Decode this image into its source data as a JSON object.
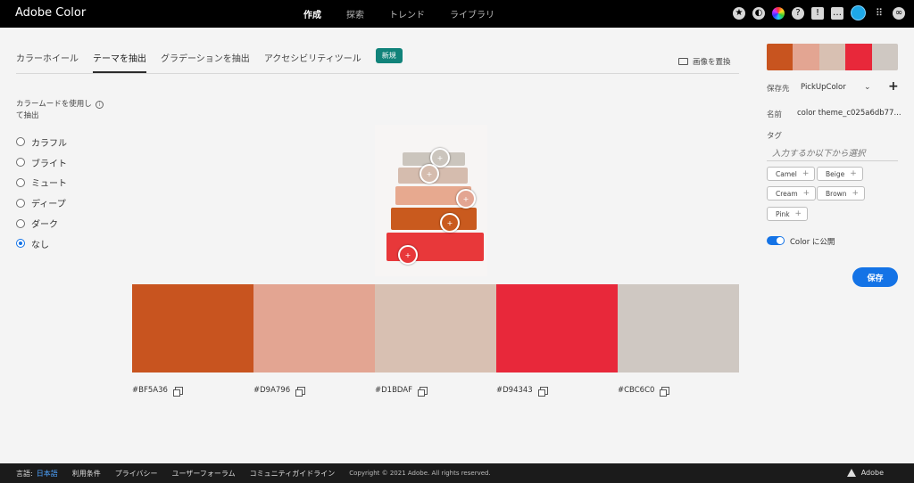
{
  "header": {
    "brand": "Adobe Color",
    "nav": [
      "作成",
      "探索",
      "トレンド",
      "ライブラリ"
    ],
    "icons": [
      "star-icon",
      "contrast-icon",
      "color-wheel-icon",
      "help-icon",
      "notification-icon",
      "chat-icon",
      "avatar",
      "apps-grid-icon",
      "creative-cloud-icon"
    ]
  },
  "tabs": [
    {
      "label": "カラーホイール"
    },
    {
      "label": "テーマを抽出"
    },
    {
      "label": "グラデーションを抽出"
    },
    {
      "label": "アクセシビリティツール"
    }
  ],
  "tab_badge": "新規",
  "replace_image": "画像を置換",
  "mood": {
    "title": "カラームードを使用して抽出",
    "options": [
      "カラフル",
      "ブライト",
      "ミュート",
      "ディープ",
      "ダーク",
      "なし"
    ],
    "selected": "なし"
  },
  "swatches": [
    {
      "hex": "#BF5A36",
      "color": "#c8541f"
    },
    {
      "hex": "#D9A796",
      "color": "#e3a592"
    },
    {
      "hex": "#D1BDAF",
      "color": "#d8c0b2"
    },
    {
      "hex": "#D94343",
      "color": "#e8283a"
    },
    {
      "hex": "#CBC6C0",
      "color": "#cfc8c2"
    }
  ],
  "panel": {
    "save_to_label": "保存先",
    "save_to_value": "PickUpColor",
    "name_label": "名前",
    "name_value": "color theme_c025a6db77...",
    "tag_label": "タグ",
    "tag_placeholder": "入力するか以下から選択",
    "tags": [
      "Camel",
      "Beige",
      "Cream",
      "Brown",
      "Pink"
    ],
    "publish_label": "Color に公開",
    "save_button": "保存"
  },
  "footer": {
    "language_label": "言語:",
    "language_value": "日本語",
    "links": [
      "利用条件",
      "プライバシー",
      "ユーザーフォーラム",
      "コミュニティガイドライン"
    ],
    "copyright": "Copyright © 2021 Adobe. All rights reserved.",
    "logo_text": "Adobe"
  }
}
